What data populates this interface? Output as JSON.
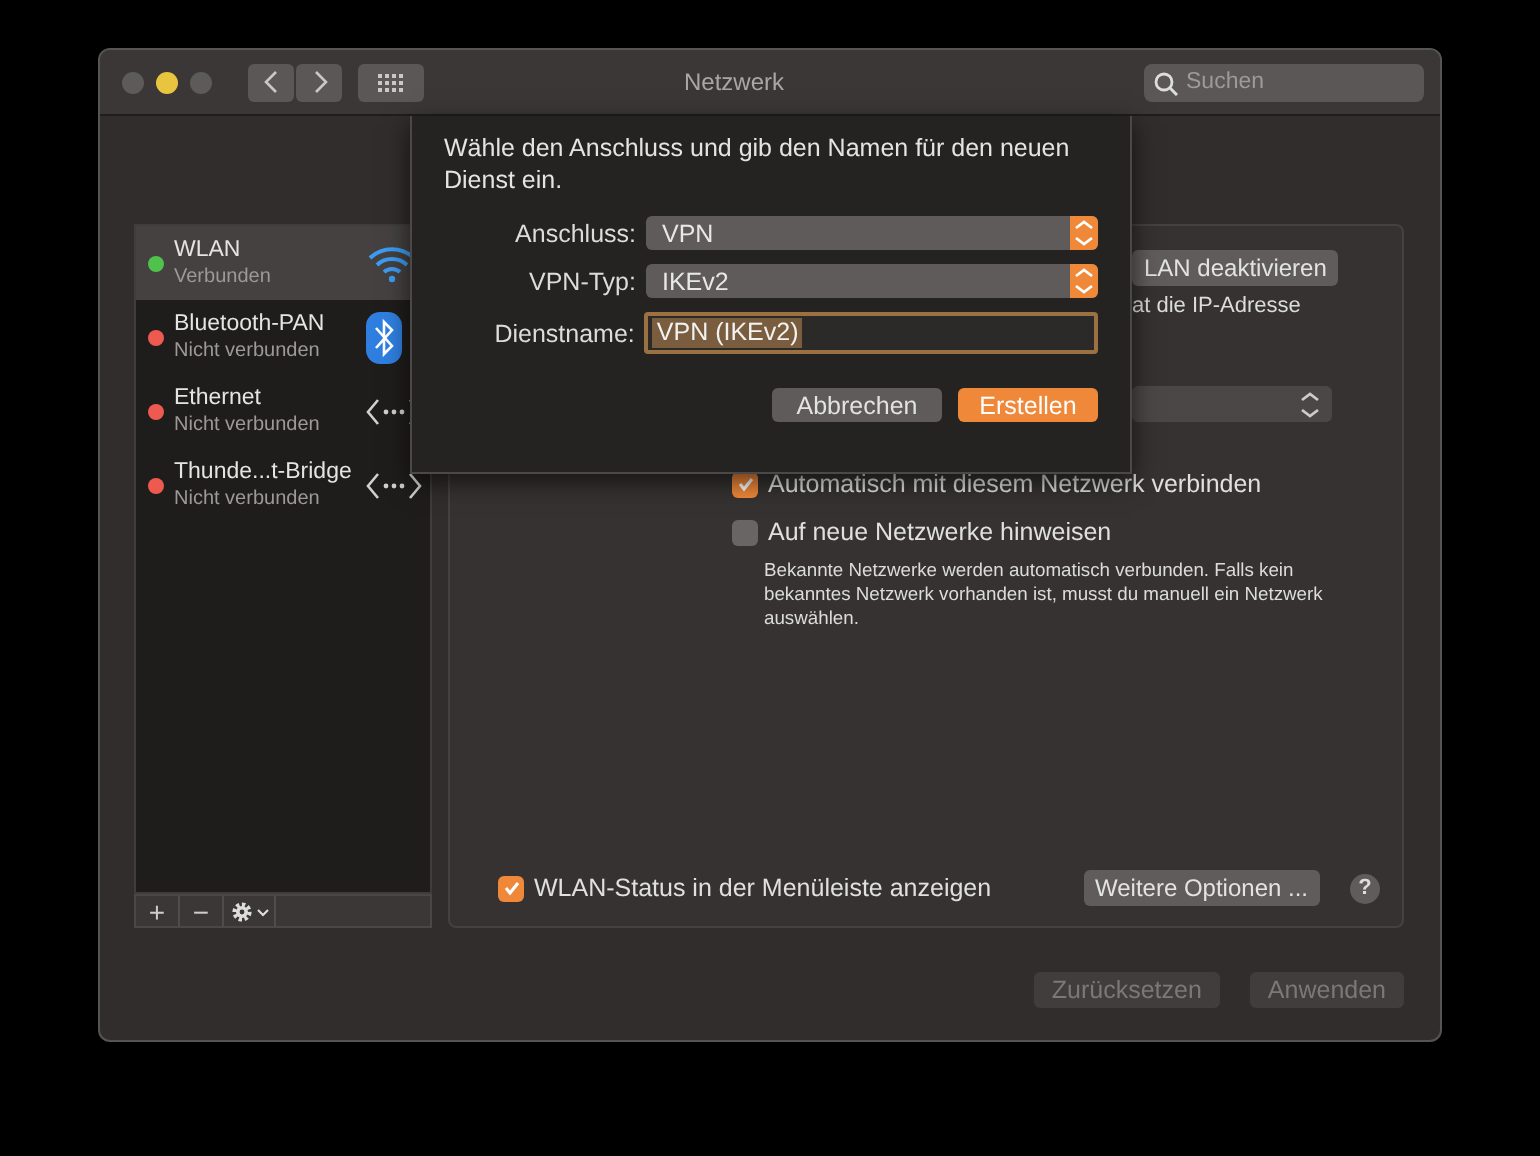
{
  "window": {
    "title": "Netzwerk",
    "search": {
      "placeholder": "Suchen"
    }
  },
  "services": [
    {
      "name": "WLAN",
      "status": "Verbunden",
      "color": "#4fc24c",
      "selected": true,
      "kind": "wifi"
    },
    {
      "name": "Bluetooth-PAN",
      "status": "Nicht verbunden",
      "color": "#ee5a50",
      "selected": false,
      "kind": "bluetooth"
    },
    {
      "name": "Ethernet",
      "status": "Nicht verbunden",
      "color": "#ee5a50",
      "selected": false,
      "kind": "ethernet"
    },
    {
      "name": "Thunde...t-Bridge",
      "status": "Nicht verbunden",
      "color": "#ee5a50",
      "selected": false,
      "kind": "ethernet"
    }
  ],
  "sidebar_toolbar": {
    "add": "+",
    "remove": "−"
  },
  "panel": {
    "toggle_button": "LAN deaktivieren",
    "status_text": "at die IP-Adresse",
    "checkboxes": [
      {
        "label": "Automatisch mit diesem Netzwerk verbinden",
        "checked": true
      },
      {
        "label": "Auf neue Netzwerke hinweisen",
        "checked": false
      }
    ],
    "hint": "Bekannte Netzwerke werden automatisch verbunden. Falls kein bekanntes Netzwerk vorhanden ist, musst du manuell ein Netzwerk auswählen.",
    "menubar_checkbox": {
      "label": "WLAN-Status in der Menüleiste anzeigen",
      "checked": true
    },
    "options_button": "Weitere Optionen ...",
    "help": "?"
  },
  "buttons": [
    {
      "label": "Zurücksetzen",
      "disabled": true
    },
    {
      "label": "Anwenden",
      "disabled": true
    }
  ],
  "sheet": {
    "message": "Wähle den Anschluss und gib den Namen für den neuen Dienst ein.",
    "fields": [
      {
        "label": "Anschluss:",
        "value": "VPN",
        "kind": "popup"
      },
      {
        "label": "VPN-Typ:",
        "value": "IKEv2",
        "kind": "popup"
      },
      {
        "label": "Dienstname:",
        "value": "VPN (IKEv2)",
        "kind": "text"
      }
    ],
    "buttons": [
      {
        "label": "Abbrechen",
        "default": false
      },
      {
        "label": "Erstellen",
        "default": true
      }
    ]
  }
}
